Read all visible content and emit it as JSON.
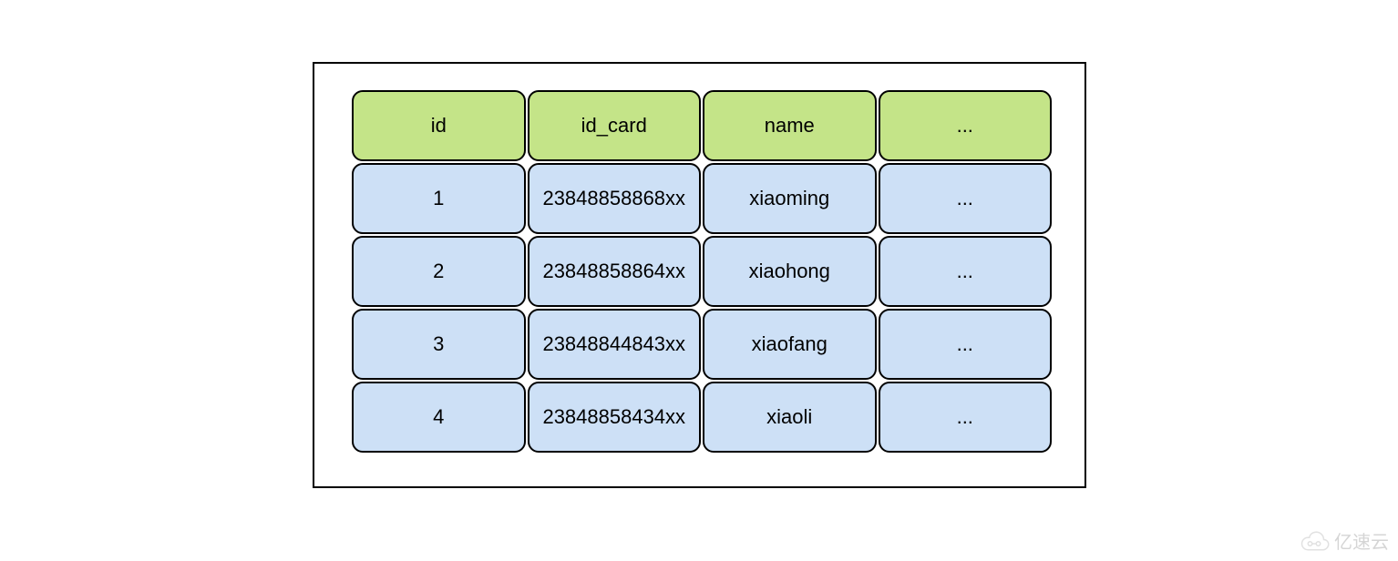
{
  "table": {
    "headers": [
      "id",
      "id_card",
      "name",
      "..."
    ],
    "rows": [
      [
        "1",
        "23848858868xx",
        "xiaoming",
        "..."
      ],
      [
        "2",
        "23848858864xx",
        "xiaohong",
        "..."
      ],
      [
        "3",
        "23848844843xx",
        "xiaofang",
        "..."
      ],
      [
        "4",
        "23848858434xx",
        "xiaoli",
        "..."
      ]
    ]
  },
  "watermark": {
    "text": "亿速云"
  }
}
